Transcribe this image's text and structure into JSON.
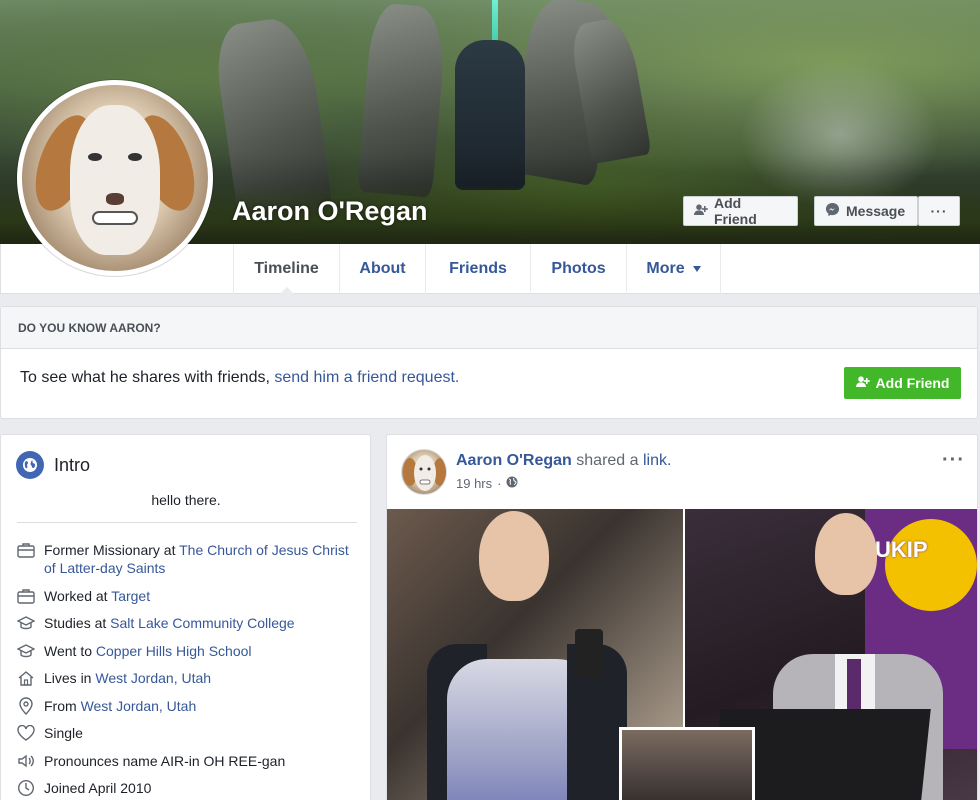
{
  "profile": {
    "name": "Aaron O'Regan",
    "add_friend_label": "Add Friend",
    "message_label": "Message",
    "more_dots": "···"
  },
  "nav": {
    "tabs": [
      {
        "label": "Timeline",
        "active": true
      },
      {
        "label": "About"
      },
      {
        "label": "Friends"
      },
      {
        "label": "Photos"
      },
      {
        "label": "More"
      }
    ]
  },
  "know_box": {
    "heading": "DO YOU KNOW AARON?",
    "text_prefix": "To see what he shares with friends,",
    "text_link": "send him a friend request.",
    "button_label": "Add Friend"
  },
  "intro": {
    "title": "Intro",
    "bio": "hello there.",
    "items": [
      {
        "icon": "briefcase-icon",
        "prefix": "Former Missionary at",
        "link": "The Church of Jesus Christ of Latter-day Saints"
      },
      {
        "icon": "briefcase-icon",
        "prefix": "Worked at",
        "link": "Target"
      },
      {
        "icon": "graduation-cap-icon",
        "prefix": "Studies at",
        "link": "Salt Lake Community College"
      },
      {
        "icon": "graduation-cap-icon",
        "prefix": "Went to",
        "link": "Copper Hills High School"
      },
      {
        "icon": "home-icon",
        "prefix": "Lives in",
        "link": "West Jordan, Utah"
      },
      {
        "icon": "location-pin-icon",
        "prefix": "From",
        "link": "West Jordan, Utah"
      },
      {
        "icon": "heart-icon",
        "prefix": "Single",
        "link": ""
      },
      {
        "icon": "speaker-icon",
        "prefix": "Pronounces name AIR-in OH REE-gan",
        "link": ""
      },
      {
        "icon": "clock-icon",
        "prefix": "Joined April 2010",
        "link": ""
      }
    ]
  },
  "post": {
    "author": "Aaron O'Regan",
    "action": "shared a",
    "action_link": "link.",
    "time": "19 hrs",
    "dots": "···",
    "ukip_text": "UKIP"
  },
  "colors": {
    "link": "#365899",
    "green": "#42b72a",
    "badge_blue": "#4267b2"
  }
}
